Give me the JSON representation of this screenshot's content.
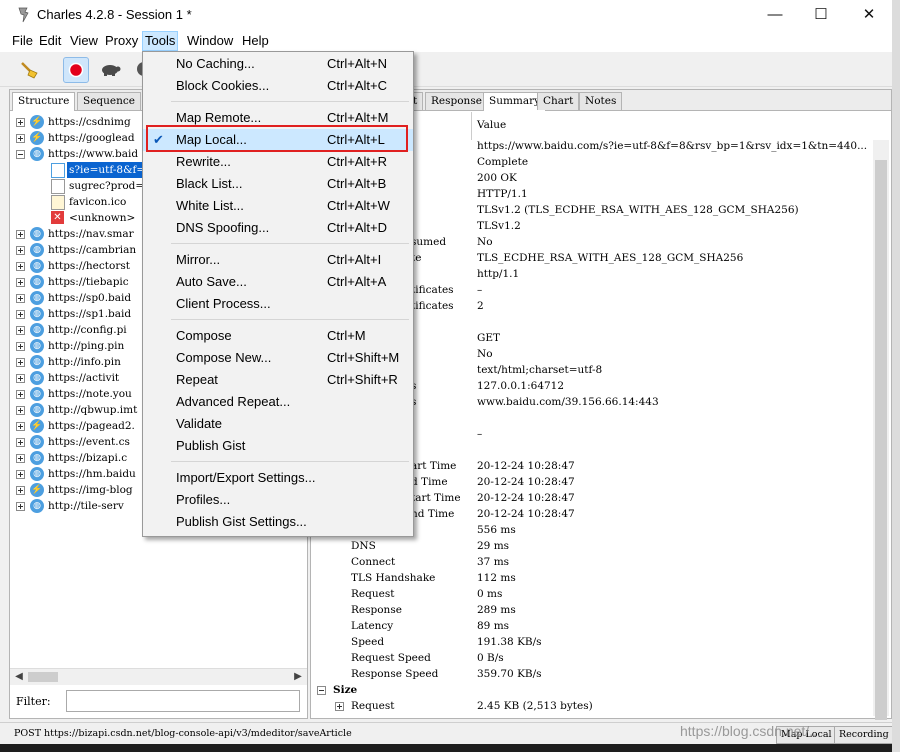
{
  "window": {
    "title": "Charles 4.2.8 - Session 1 *",
    "controls": {
      "minimize": "—",
      "maximize": "☐",
      "close": "✕"
    }
  },
  "menubar": [
    "File",
    "Edit",
    "View",
    "Proxy",
    "Tools",
    "Window",
    "Help"
  ],
  "tools_menu": {
    "items": [
      {
        "label": "No Caching...",
        "shortcut": "Ctrl+Alt+N"
      },
      {
        "label": "Block Cookies...",
        "shortcut": "Ctrl+Alt+C"
      },
      {
        "label": "Map Remote...",
        "shortcut": "Ctrl+Alt+M"
      },
      {
        "label": "Map Local...",
        "shortcut": "Ctrl+Alt+L",
        "checked": true,
        "highlighted": true
      },
      {
        "label": "Rewrite...",
        "shortcut": "Ctrl+Alt+R"
      },
      {
        "label": "Black List...",
        "shortcut": "Ctrl+Alt+B"
      },
      {
        "label": "White List...",
        "shortcut": "Ctrl+Alt+W"
      },
      {
        "label": "DNS Spoofing...",
        "shortcut": "Ctrl+Alt+D"
      },
      {
        "label": "Mirror...",
        "shortcut": "Ctrl+Alt+I"
      },
      {
        "label": "Auto Save...",
        "shortcut": "Ctrl+Alt+A"
      },
      {
        "label": "Client Process...",
        "shortcut": ""
      },
      {
        "label": "Compose",
        "shortcut": "Ctrl+M"
      },
      {
        "label": "Compose New...",
        "shortcut": "Ctrl+Shift+M"
      },
      {
        "label": "Repeat",
        "shortcut": "Ctrl+Shift+R"
      },
      {
        "label": "Advanced Repeat...",
        "shortcut": ""
      },
      {
        "label": "Validate",
        "shortcut": ""
      },
      {
        "label": "Publish Gist",
        "shortcut": ""
      },
      {
        "label": "Import/Export Settings...",
        "shortcut": ""
      },
      {
        "label": "Profiles...",
        "shortcut": ""
      },
      {
        "label": "Publish Gist Settings...",
        "shortcut": ""
      }
    ]
  },
  "left_panel": {
    "tabs": [
      "Structure",
      "Sequence"
    ],
    "tree": [
      {
        "label": "https://csdnimg",
        "type": "host"
      },
      {
        "label": "https://googlead",
        "type": "host"
      },
      {
        "label": "https://www.baid",
        "type": "host",
        "expanded": true
      },
      {
        "label": "s?ie=utf-8&f=8",
        "type": "req",
        "selected": true
      },
      {
        "label": "sugrec?prod=",
        "type": "file"
      },
      {
        "label": "favicon.ico",
        "type": "file"
      },
      {
        "label": "<unknown>",
        "type": "error"
      },
      {
        "label": "https://nav.smar",
        "type": "host"
      },
      {
        "label": "https://cambrian",
        "type": "host"
      },
      {
        "label": "https://hectorst",
        "type": "host"
      },
      {
        "label": "https://tiebapic",
        "type": "host"
      },
      {
        "label": "https://sp0.baid",
        "type": "host"
      },
      {
        "label": "https://sp1.baid",
        "type": "host"
      },
      {
        "label": "http://config.pi",
        "type": "host"
      },
      {
        "label": "http://ping.pin",
        "type": "host"
      },
      {
        "label": "http://info.pin",
        "type": "host"
      },
      {
        "label": "https://activit",
        "type": "host"
      },
      {
        "label": "https://note.you",
        "type": "host"
      },
      {
        "label": "http://qbwup.imt",
        "type": "host"
      },
      {
        "label": "https://pagead2.",
        "type": "host"
      },
      {
        "label": "https://event.cs",
        "type": "host"
      },
      {
        "label": "https://bizapi.c",
        "type": "host"
      },
      {
        "label": "https://hm.baidu",
        "type": "host"
      },
      {
        "label": "https://img-blog",
        "type": "host"
      },
      {
        "label": "http://tile-serv",
        "type": "host"
      }
    ],
    "filter_label": "Filter:",
    "filter_value": ""
  },
  "right_panel": {
    "tabs": [
      "t",
      "Response",
      "Summary",
      "Chart",
      "Notes"
    ],
    "column_value": "Value",
    "rows": [
      {
        "name": "",
        "value": "https://www.baidu.com/s?ie=utf-8&f=8&rsv_bp=1&rsv_idx=1&tn=440..."
      },
      {
        "name": "",
        "value": "Complete"
      },
      {
        "name": "",
        "value": "200 OK"
      },
      {
        "name": "",
        "value": "HTTP/1.1"
      },
      {
        "name": "",
        "value": "TLSv1.2 (TLS_ECDHE_RSA_WITH_AES_128_GCM_SHA256)"
      },
      {
        "name": "",
        "value": "TLSv1.2"
      },
      {
        "name": "sumed",
        "value": "No"
      },
      {
        "name": "te",
        "value": "TLS_ECDHE_RSA_WITH_AES_128_GCM_SHA256"
      },
      {
        "name": "",
        "value": "http/1.1"
      },
      {
        "name": "tificates",
        "value": "–"
      },
      {
        "name": "tificates",
        "value": "2"
      },
      {
        "name": "",
        "value": ""
      },
      {
        "name": "",
        "value": "GET"
      },
      {
        "name": "",
        "value": "No"
      },
      {
        "name": "",
        "value": "text/html;charset=utf-8"
      },
      {
        "name": "s",
        "value": "127.0.0.1:64712"
      },
      {
        "name": "s",
        "value": "www.baidu.com/39.156.66.14:443"
      },
      {
        "name": "",
        "value": ""
      },
      {
        "name": "",
        "value": "–"
      },
      {
        "name": "",
        "value": ""
      },
      {
        "name": "art Time",
        "value": "20-12-24 10:28:47"
      },
      {
        "name": "d Time",
        "value": "20-12-24 10:28:47"
      },
      {
        "name": "tart Time",
        "value": "20-12-24 10:28:47"
      },
      {
        "name": "nd Time",
        "value": "20-12-24 10:28:47"
      },
      {
        "name": "",
        "value": "556 ms"
      },
      {
        "name": "DNS",
        "value": "29 ms"
      },
      {
        "name": "Connect",
        "value": "37 ms"
      },
      {
        "name": "TLS Handshake",
        "value": "112 ms"
      },
      {
        "name": "Request",
        "value": "0 ms"
      },
      {
        "name": "Response",
        "value": "289 ms"
      },
      {
        "name": "Latency",
        "value": "89 ms"
      },
      {
        "name": "Speed",
        "value": "191.38 KB/s"
      },
      {
        "name": "Request Speed",
        "value": "0 B/s"
      },
      {
        "name": "Response Speed",
        "value": "359.70 KB/s"
      },
      {
        "name": "Size",
        "value": ""
      },
      {
        "name": "Request",
        "value": "2.45 KB (2,513 bytes)"
      }
    ]
  },
  "statusbar": {
    "text": "POST https://bizapi.csdn.net/blog-console-api/v3/mdeditor/saveArticle",
    "map_local": "Map Local",
    "recording": "Recording"
  },
  "watermark": "https://blog.csdn.net/..."
}
